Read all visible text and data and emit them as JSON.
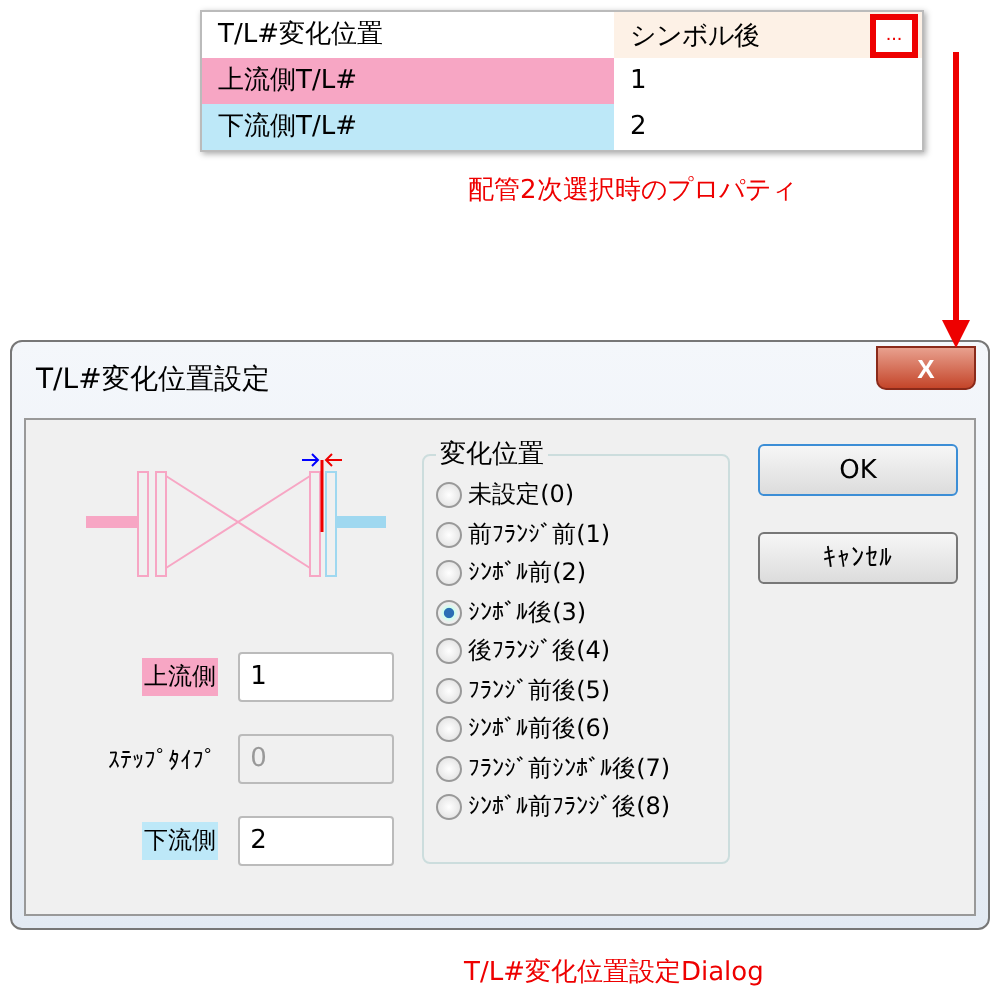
{
  "property_grid": {
    "rows": [
      {
        "label": "T/L#変化位置",
        "value": "シンボル後",
        "color": "#ffffff",
        "selected": true,
        "ellipsis_button": "..."
      },
      {
        "label": "上流側T/L#",
        "value": "1",
        "color": "#f7a6c4",
        "selected": false
      },
      {
        "label": "下流側T/L#",
        "value": "2",
        "color": "#bde8f8",
        "selected": false
      }
    ]
  },
  "note": "配管2次選択時のプロパティ",
  "dialog": {
    "title": "T/L#変化位置設定",
    "close_button": "X",
    "fields": [
      {
        "label": "上流側",
        "value": "1",
        "color": "#f7a6c4",
        "disabled": false
      },
      {
        "label": "ｽﾃｯﾌﾟﾀｲﾌﾟ",
        "value": "0",
        "disabled": true
      },
      {
        "label": "下流側",
        "value": "2",
        "color": "#bde8f8",
        "disabled": false
      }
    ],
    "group_title": "変化位置",
    "options": [
      {
        "label": "未設定(0)",
        "selected": false
      },
      {
        "label": "前ﾌﾗﾝｼﾞ前(1)",
        "selected": false
      },
      {
        "label": "ｼﾝﾎﾞﾙ前(2)",
        "selected": false
      },
      {
        "label": "ｼﾝﾎﾞﾙ後(3)",
        "selected": true
      },
      {
        "label": "後ﾌﾗﾝｼﾞ後(4)",
        "selected": false
      },
      {
        "label": "ﾌﾗﾝｼﾞ前後(5)",
        "selected": false
      },
      {
        "label": "ｼﾝﾎﾞﾙ前後(6)",
        "selected": false
      },
      {
        "label": "ﾌﾗﾝｼﾞ前ｼﾝﾎﾞﾙ後(7)",
        "selected": false
      },
      {
        "label": "ｼﾝﾎﾞﾙ前ﾌﾗﾝｼﾞ後(8)",
        "selected": false
      }
    ],
    "buttons": [
      {
        "label": "OK",
        "default": true
      },
      {
        "label": "ｷｬﾝｾﾙ",
        "default": false
      }
    ]
  },
  "caption": "T/L#変化位置設定Dialog"
}
